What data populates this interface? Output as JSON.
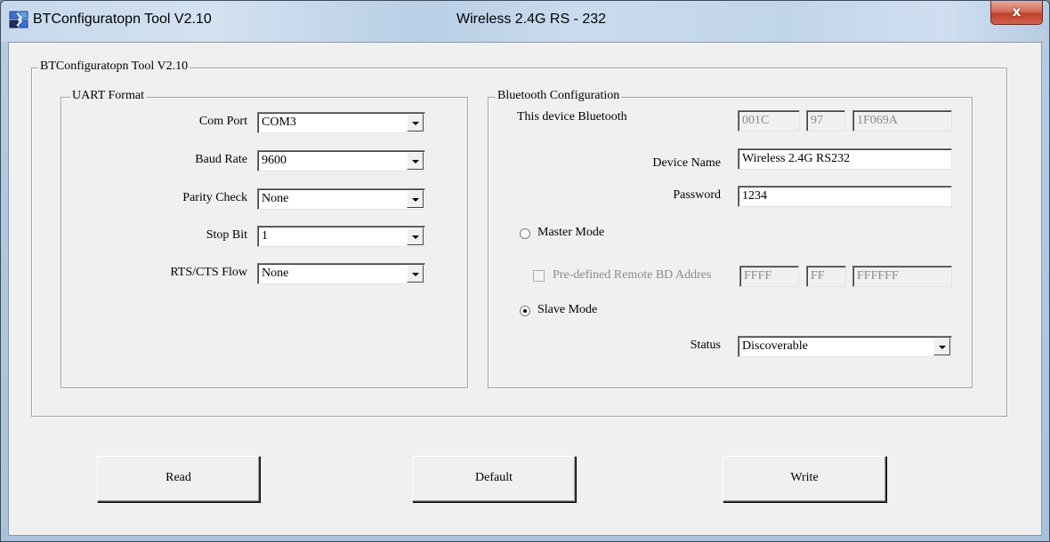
{
  "window": {
    "title": "BTConfiguratopn Tool V2.10",
    "center_title": "Wireless 2.4G RS - 232",
    "close_glyph": "x",
    "icon": "bluetooth-app-icon"
  },
  "main_group": {
    "title": "BTConfiguratopn Tool V2.10"
  },
  "uart": {
    "title": "UART Format",
    "com_port": {
      "label": "Com Port",
      "value": "COM3"
    },
    "baud_rate": {
      "label": "Baud Rate",
      "value": "9600"
    },
    "parity_check": {
      "label": "Parity Check",
      "value": "None"
    },
    "stop_bit": {
      "label": "Stop Bit",
      "value": "1"
    },
    "rts_cts_flow": {
      "label": "RTS/CTS Flow",
      "value": "None"
    }
  },
  "bluetooth": {
    "title": "Bluetooth Configuration",
    "device_bt_label": "This device Bluetooth",
    "device_bt_addr": [
      "001C",
      "97",
      "1F069A"
    ],
    "device_name": {
      "label": "Device Name",
      "value": "Wireless 2.4G RS232"
    },
    "password": {
      "label": "Password",
      "value": "1234"
    },
    "master_mode": {
      "label": "Master Mode",
      "selected": false
    },
    "predefined": {
      "label": "Pre-defined Remote BD Addres",
      "checked": false,
      "addr": [
        "FFFF",
        "FF",
        "FFFFFF"
      ]
    },
    "slave_mode": {
      "label": "Slave Mode",
      "selected": true
    },
    "status": {
      "label": "Status",
      "value": "Discoverable"
    }
  },
  "buttons": {
    "read": "Read",
    "default": "Default",
    "write": "Write"
  }
}
